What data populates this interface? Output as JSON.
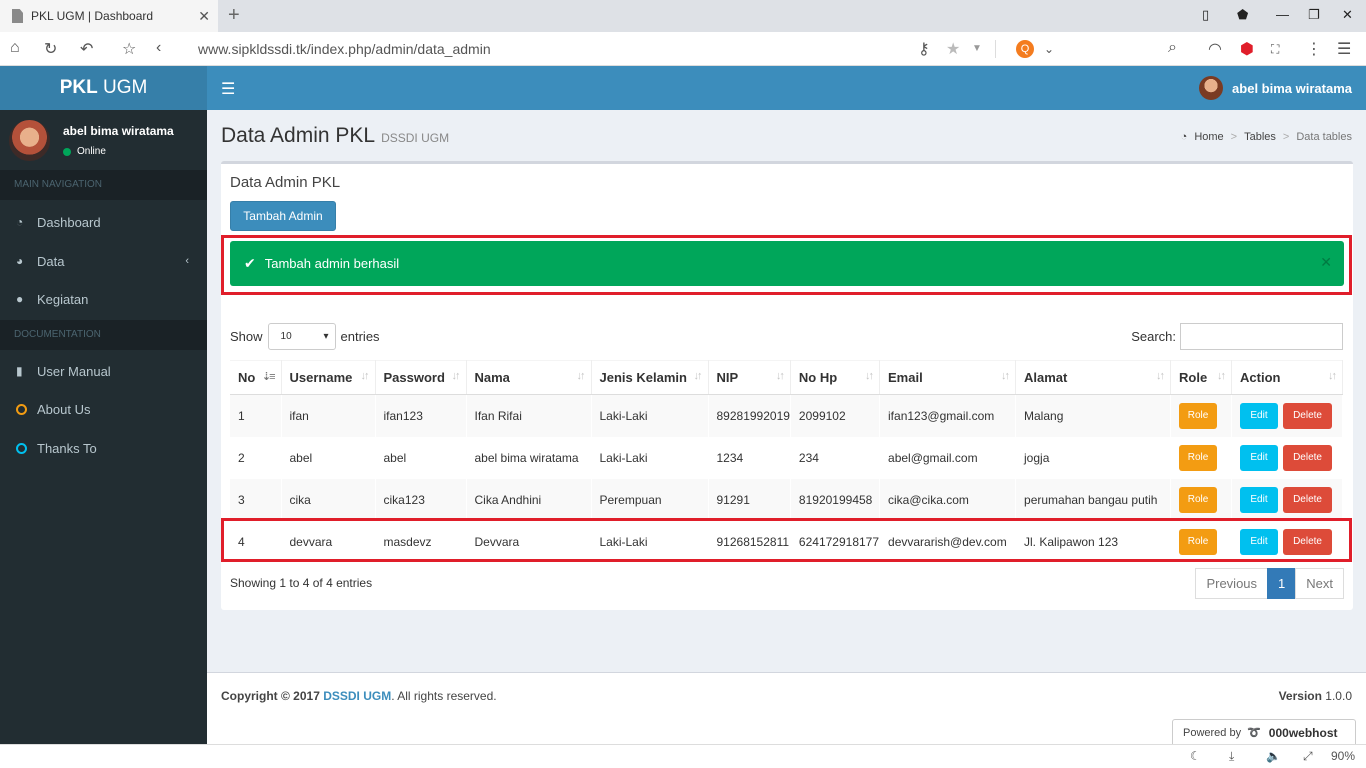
{
  "browser": {
    "tab_title": "PKL UGM | Dashboard",
    "url": "www.sipkldssdi.tk/index.php/admin/data_admin",
    "zoom": "90%"
  },
  "header": {
    "logo_bold": "PKL",
    "logo_rest": " UGM",
    "user_name": "abel bima wiratama"
  },
  "sidebar": {
    "user_name": "abel bima wiratama",
    "status": "Online",
    "main_nav_header": "MAIN NAVIGATION",
    "doc_header": "DOCUMENTATION",
    "items": [
      {
        "label": "Dashboard"
      },
      {
        "label": "Data"
      },
      {
        "label": "Kegiatan"
      },
      {
        "label": "User Manual"
      },
      {
        "label": "About Us"
      },
      {
        "label": "Thanks To"
      }
    ]
  },
  "page": {
    "title": "Data Admin PKL",
    "subtitle": "DSSDI UGM",
    "breadcrumb": [
      "Home",
      "Tables",
      "Data tables"
    ]
  },
  "box": {
    "title": "Data Admin PKL",
    "add_button": "Tambah Admin",
    "alert": "Tambah admin berhasil",
    "show_label": "Show",
    "entries_value": "10",
    "entries_label": "entries",
    "search_label": "Search:",
    "columns": [
      "No",
      "Username",
      "Password",
      "Nama",
      "Jenis Kelamin",
      "NIP",
      "No Hp",
      "Email",
      "Alamat",
      "Role",
      "Action"
    ],
    "rows": [
      {
        "no": "1",
        "username": "ifan",
        "password": "ifan123",
        "nama": "Ifan Rifai",
        "jk": "Laki-Laki",
        "nip": "89281992019",
        "hp": "2099102",
        "email": "ifan123@gmail.com",
        "alamat": "Malang"
      },
      {
        "no": "2",
        "username": "abel",
        "password": "abel",
        "nama": "abel bima wiratama",
        "jk": "Laki-Laki",
        "nip": "1234",
        "hp": "234",
        "email": "abel@gmail.com",
        "alamat": "jogja"
      },
      {
        "no": "3",
        "username": "cika",
        "password": "cika123",
        "nama": "Cika Andhini",
        "jk": "Perempuan",
        "nip": "91291",
        "hp": "81920199458",
        "email": "cika@cika.com",
        "alamat": "perumahan bangau putih"
      },
      {
        "no": "4",
        "username": "devvara",
        "password": "masdevz",
        "nama": "Devvara",
        "jk": "Laki-Laki",
        "nip": "91268152811",
        "hp": "624172918177",
        "email": "devvararish@dev.com",
        "alamat": "Jl. Kalipawon 123"
      }
    ],
    "role_btn": "Role",
    "edit_btn": "Edit",
    "delete_btn": "Delete",
    "info": "Showing 1 to 4 of 4 entries",
    "pager": {
      "prev": "Previous",
      "page": "1",
      "next": "Next"
    }
  },
  "footer": {
    "copyright": "Copyright © 2017 ",
    "org": "DSSDI UGM",
    "rights": ". All rights reserved.",
    "version_label": "Version",
    "version": "1.0.0",
    "powered": "Powered by",
    "host": "000webhost"
  },
  "colors": {
    "header": "#3c8dbc",
    "sidebar": "#222d32",
    "success": "#00a65a",
    "highlight": "#e01e2a"
  }
}
